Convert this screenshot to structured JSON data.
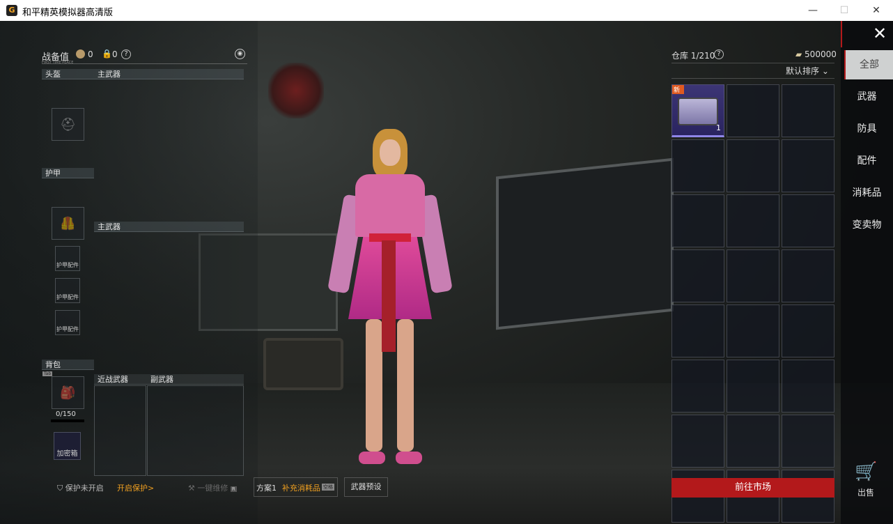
{
  "window": {
    "title": "和平精英模拟器高清版",
    "minimize": "—",
    "maximize": "☐",
    "close": "✕"
  },
  "loadout": {
    "label": "战备值",
    "subtitle": "FIRST TIME PEACE",
    "coin_value": "0",
    "lock_value": "0",
    "help": "?"
  },
  "slots": {
    "helmet": "头盔",
    "primary1": "主武器",
    "armor": "护甲",
    "primary2": "主武器",
    "armor_acc": [
      "护甲配件",
      "护甲配件",
      "护甲配件"
    ],
    "backpack": "背包",
    "tab_badge": "Tab",
    "capacity": "0/150",
    "secure_box": "加密箱",
    "melee": "近战武器",
    "secondary": "副武器"
  },
  "bottom": {
    "protect_status": "保护未开启",
    "protect_link": "开启保护>",
    "repair": "一键维修",
    "repair_key": "R",
    "plan": "方案1",
    "refill": "补充消耗品",
    "refill_key": "空格",
    "weapon_preset": "武器预设"
  },
  "warehouse": {
    "label": "仓库 1/210",
    "help": "?",
    "money": "500000",
    "sort": "默认排序",
    "items": [
      {
        "badge": "新",
        "count": "1",
        "color": "#8f86e8"
      }
    ],
    "market_button": "前往市场"
  },
  "categories": [
    "全部",
    "武器",
    "防具",
    "配件",
    "消耗品",
    "变卖物"
  ],
  "sell": "出售",
  "colors": {
    "accent": "#b3191b",
    "orange": "#f0a020"
  }
}
